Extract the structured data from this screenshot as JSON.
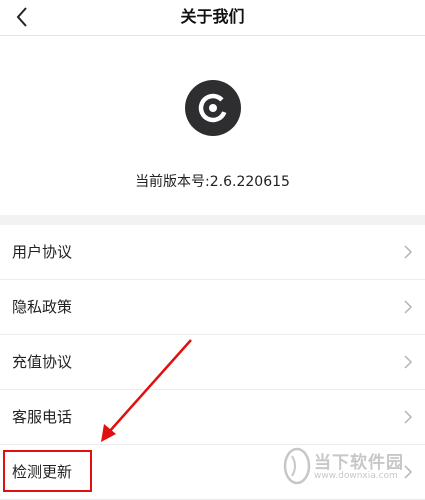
{
  "header": {
    "title": "关于我们"
  },
  "app": {
    "version_text": "当前版本号:2.6.220615"
  },
  "menu": {
    "items": [
      {
        "label": "用户协议"
      },
      {
        "label": "隐私政策"
      },
      {
        "label": "充值协议"
      },
      {
        "label": "客服电话"
      },
      {
        "label": "检测更新"
      }
    ]
  },
  "watermark": {
    "name": "当下软件园",
    "url": "www.downxia.com"
  },
  "colors": {
    "annotation": "#e01010",
    "logo_bg": "#2e2e30",
    "divider": "#ececec"
  }
}
